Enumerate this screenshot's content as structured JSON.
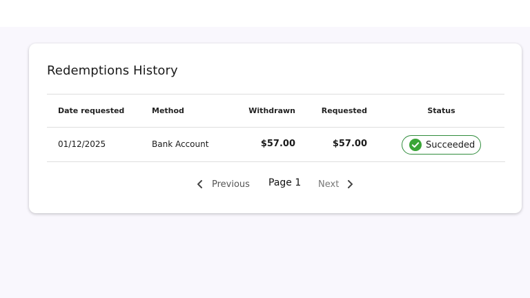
{
  "card": {
    "title": "Redemptions History"
  },
  "table": {
    "headers": {
      "date_requested": "Date requested",
      "method": "Method",
      "withdrawn": "Withdrawn",
      "requested": "Requested",
      "status": "Status"
    },
    "rows": [
      {
        "date_requested": "01/12/2025",
        "method": "Bank Account",
        "withdrawn": "$57.00",
        "requested": "$57.00",
        "status": "Succeeded"
      }
    ]
  },
  "pagination": {
    "previous_label": "Previous",
    "page_label": "Page 1",
    "next_label": "Next"
  },
  "icons": {
    "status": "check-circle-icon",
    "previous": "chevron-left-icon",
    "next": "chevron-right-icon"
  },
  "colors": {
    "success_border": "#2e8b3a",
    "success_icon": "#3aa537",
    "page_background": "#f9f7fd"
  }
}
